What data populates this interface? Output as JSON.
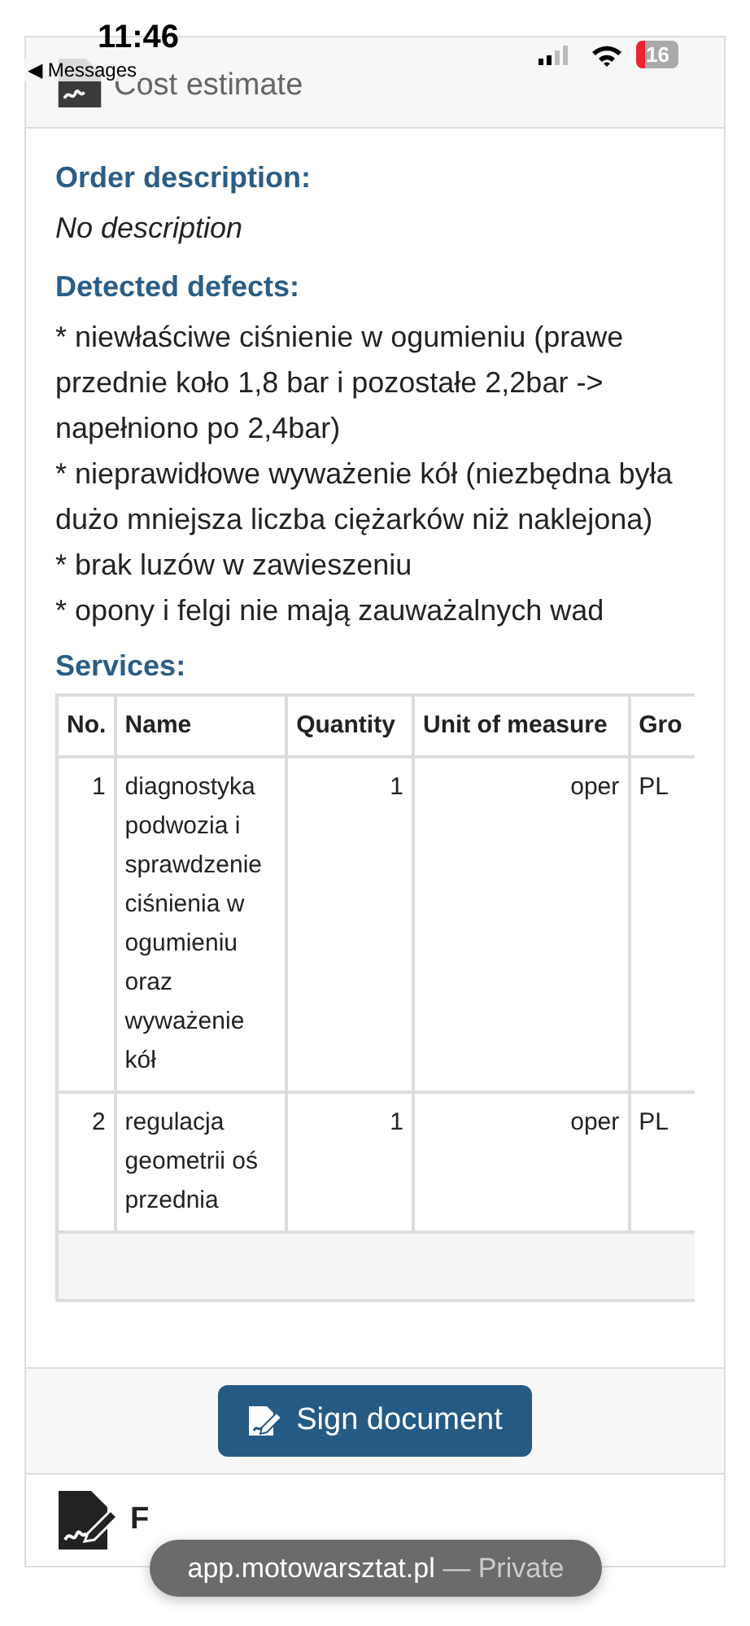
{
  "status_bar": {
    "time": "11:46",
    "back_label": "◀ Messages",
    "battery": "16"
  },
  "card": {
    "title": "Cost estimate",
    "sections": [
      {
        "kind": "text",
        "heading": "Order description:",
        "lines": [
          "No description"
        ],
        "italic": true
      },
      {
        "kind": "text",
        "heading": "Detected defects:",
        "lines": [
          "* niewłaściwe ciśnienie w ogumieniu (prawe przednie koło 1,8 bar i pozostałe 2,2bar -> napełniono po 2,4bar)",
          "* nieprawidłowe wyważenie kół (niezbędna była dużo mniejsza liczba ciężarków niż naklejona)",
          "* brak luzów w zawieszeniu",
          "* opony i felgi nie mają zauważalnych wad"
        ],
        "italic": false
      },
      {
        "kind": "table",
        "heading": "Services:",
        "columns": [
          "No.",
          "Name",
          "Quantity",
          "Unit of measure",
          "Gro"
        ],
        "rows": [
          [
            "1",
            "diagnostyka podwozia i sprawdzenie ciśnienia w ogumieniu oraz wyważenie kół",
            "1",
            "oper",
            "PL"
          ],
          [
            "2",
            "regulacja geometrii oś przednia",
            "1",
            "oper",
            "PL"
          ]
        ]
      }
    ],
    "button": "Sign document"
  },
  "next_card": {
    "title": "F"
  },
  "url_pill": {
    "host": "app.motowarsztat.pl",
    "mode": "— Private"
  }
}
